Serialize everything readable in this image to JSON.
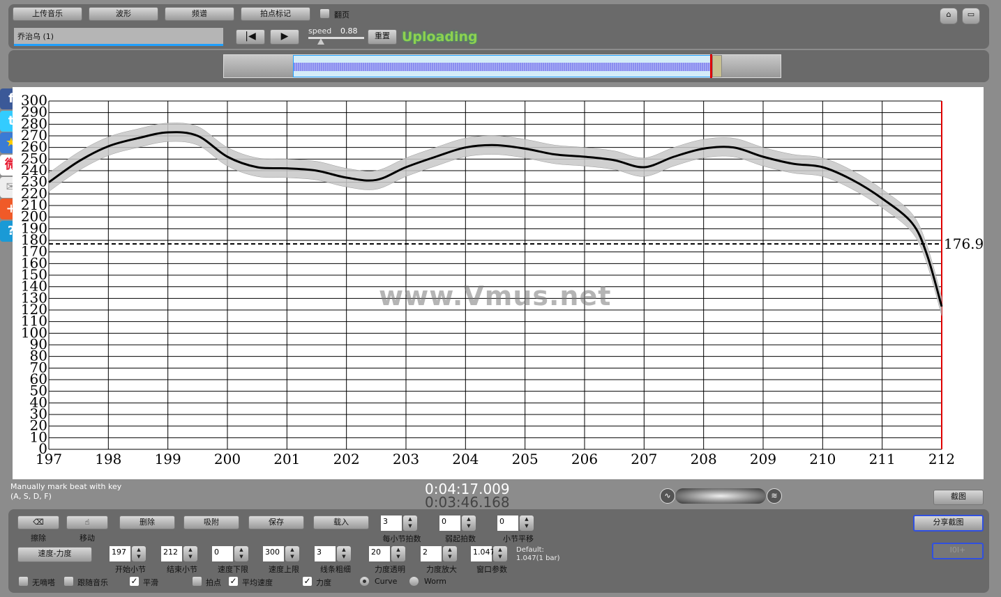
{
  "toolbar": {
    "upload": "上传音乐",
    "waveform": "波形",
    "spectrum": "频谱",
    "beat_mark": "拍点标记",
    "page_turn": "翻页",
    "song": "乔治乌 (1)",
    "speed_label": "speed",
    "speed_value": "0.88",
    "reset": "重置",
    "status": "Uploading"
  },
  "watermark": "www.Vmus.net",
  "hint": [
    "Manually mark beat with key",
    "(A, S, D, F)"
  ],
  "times": {
    "total": "0:04:17.009",
    "current": "0:03:46.168"
  },
  "screenshot": "截图",
  "share_screenshot": "分享截图",
  "disabled_btn": "I0I+",
  "tools": {
    "erase": "擦除",
    "move": "移动",
    "delete": "删除",
    "snap": "吸附",
    "save": "保存",
    "load": "载入",
    "tempo_dyn": "速度-力度"
  },
  "spinners": [
    {
      "value": "3",
      "label": "每小节拍数"
    },
    {
      "value": "0",
      "label": "弱起拍数"
    },
    {
      "value": "0",
      "label": "小节平移"
    },
    {
      "value": "197",
      "label": "开始小节"
    },
    {
      "value": "212",
      "label": "结束小节"
    },
    {
      "value": "0",
      "label": "速度下限"
    },
    {
      "value": "300",
      "label": "速度上限"
    },
    {
      "value": "3",
      "label": "线条粗细"
    },
    {
      "value": "20",
      "label": "力度透明"
    },
    {
      "value": "2",
      "label": "力度放大"
    },
    {
      "value": "1.047",
      "label": "窗口参数"
    }
  ],
  "default_note": [
    "Default:",
    "1.047(1 bar)"
  ],
  "checks": [
    {
      "label": "无嘀嗒",
      "checked": false
    },
    {
      "label": "跟随音乐",
      "checked": false
    },
    {
      "label": "平滑",
      "checked": true
    },
    {
      "label": "拍点",
      "checked": false
    },
    {
      "label": "平均速度",
      "checked": true
    },
    {
      "label": "力度",
      "checked": true
    }
  ],
  "radios": [
    {
      "label": "Curve",
      "selected": true
    },
    {
      "label": "Worm",
      "selected": false
    }
  ],
  "colors": {
    "accent": "#8fd14f",
    "band": "#c8c8c8",
    "endline": "#e00000"
  },
  "chart_data": {
    "type": "line",
    "xlim": [
      197,
      212
    ],
    "ylim": [
      0,
      300
    ],
    "xticks": [
      "197",
      "198",
      "199",
      "200",
      "201",
      "202",
      "203",
      "204",
      "205",
      "206",
      "207",
      "208",
      "209",
      "210",
      "211",
      "212"
    ],
    "yticks": [
      0,
      10,
      20,
      30,
      40,
      50,
      60,
      70,
      80,
      90,
      100,
      110,
      120,
      130,
      140,
      150,
      160,
      170,
      180,
      190,
      200,
      210,
      220,
      230,
      240,
      250,
      260,
      270,
      280,
      290,
      300
    ],
    "grid": true,
    "x": [
      197,
      197.5,
      198,
      198.5,
      199,
      199.5,
      200,
      200.5,
      201,
      201.5,
      202,
      202.5,
      203,
      203.5,
      204,
      204.5,
      205,
      205.5,
      206,
      206.5,
      207,
      207.5,
      208,
      208.5,
      209,
      209.5,
      210,
      210.5,
      211,
      211.5,
      211.75,
      212
    ],
    "y": [
      230,
      248,
      261,
      268,
      273,
      270,
      252,
      243,
      242,
      240,
      234,
      232,
      243,
      252,
      260,
      262,
      259,
      254,
      252,
      249,
      243,
      252,
      259,
      260,
      252,
      246,
      243,
      232,
      216,
      195,
      168,
      123
    ],
    "band_halfwidth": 8,
    "average": 176.9,
    "average_label": "176.9"
  }
}
